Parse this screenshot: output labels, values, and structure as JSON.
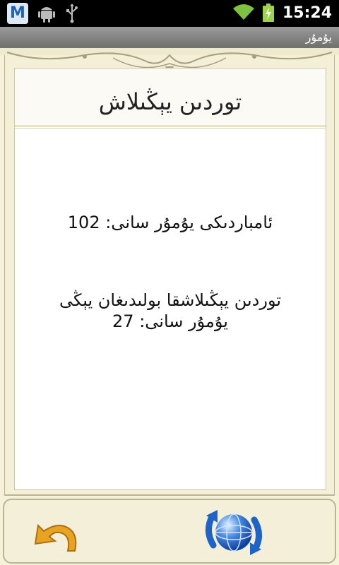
{
  "statusbar": {
    "app_icon": "M",
    "icons": [
      "m-app-icon",
      "android-icon",
      "usb-icon",
      "wifi-icon",
      "battery-charging-icon"
    ],
    "time": "15:24"
  },
  "titlebar": {
    "title": "يۇمۇر"
  },
  "page": {
    "title": "توردىن يېڭىلاش",
    "stats": [
      {
        "text": "ئامباردىكى يۇمۇر سانى: 102"
      },
      {
        "text": "توردىن يېڭىلاشقا بولىدىغان يېڭى يۇمۇر سانى: 27"
      }
    ]
  },
  "toolbar": {
    "back_icon": "undo-arrow-icon",
    "refresh_icon": "globe-refresh-icon"
  }
}
